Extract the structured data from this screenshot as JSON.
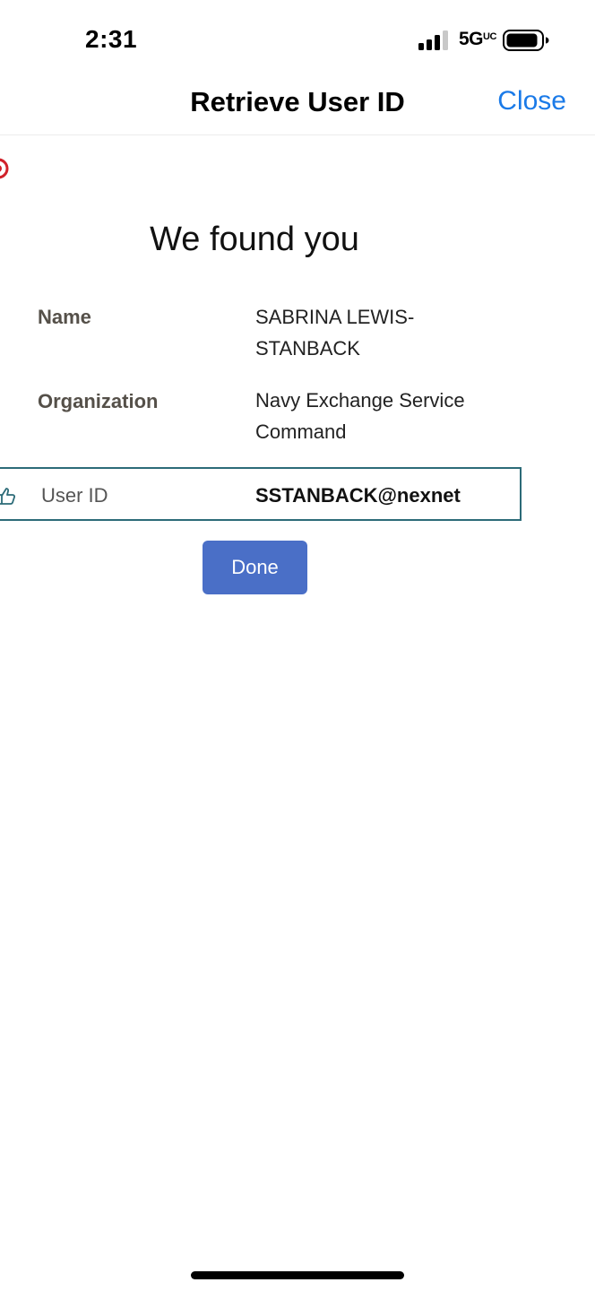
{
  "status_bar": {
    "time": "2:31",
    "network": "5G",
    "network_suffix": "UC"
  },
  "nav": {
    "title": "Retrieve User ID",
    "close_label": "Close"
  },
  "content": {
    "heading": "We found you",
    "name_label": "Name",
    "name_value": "SABRINA LEWIS-STANBACK",
    "organization_label": "Organization",
    "organization_value": "Navy Exchange Service Command",
    "user_id_label": "User ID",
    "user_id_value": "SSTANBACK@nexnet",
    "done_label": "Done"
  },
  "colors": {
    "accent_link": "#1a7ae8",
    "button": "#4a6fc7",
    "highlight_border": "#2c6b78"
  },
  "icons": {
    "signal": "cellular-signal-icon",
    "battery": "battery-icon",
    "logo": "logo-icon",
    "thumb": "thumbs-up-icon"
  }
}
